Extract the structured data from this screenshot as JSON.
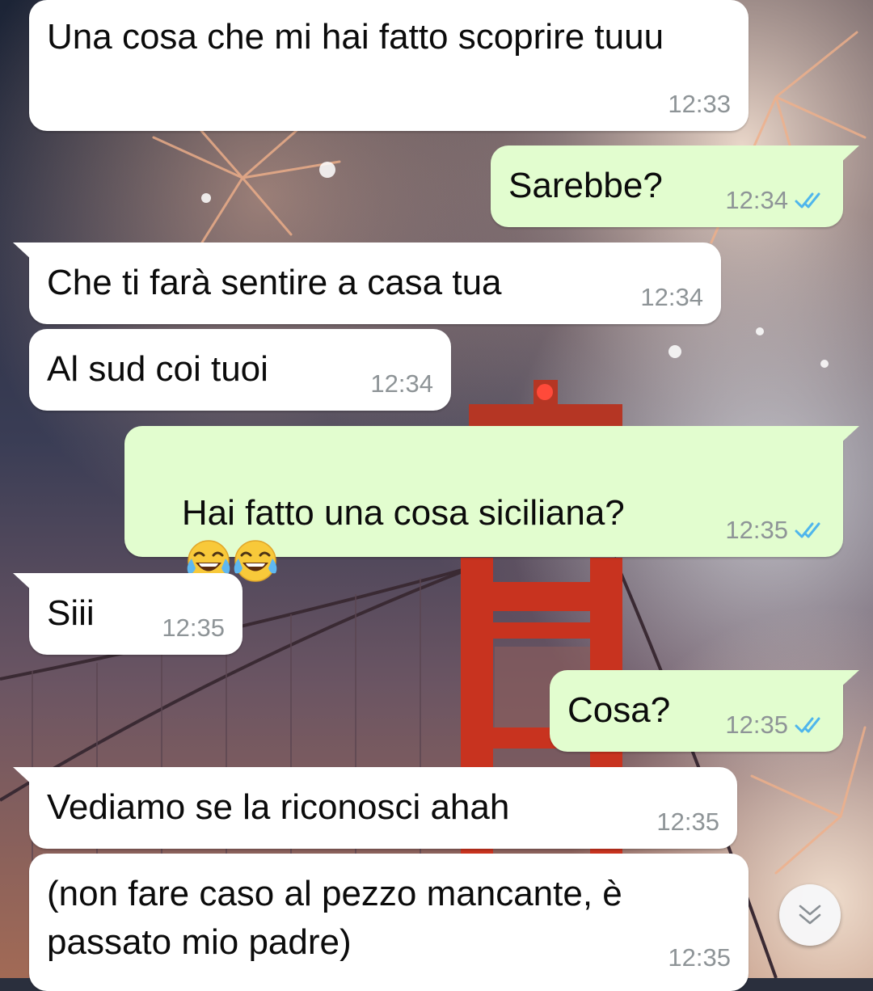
{
  "conversation": {
    "messages": [
      {
        "id": "m1",
        "direction": "incoming",
        "text": "Una cosa che mi hai fatto scoprire tuuu",
        "time": "12:33"
      },
      {
        "id": "m2",
        "direction": "outgoing",
        "text": "Sarebbe?",
        "time": "12:34",
        "status": "read"
      },
      {
        "id": "m3",
        "direction": "incoming",
        "text": "Che ti farà sentire a casa tua",
        "time": "12:34"
      },
      {
        "id": "m4",
        "direction": "incoming",
        "text": "Al sud coi tuoi",
        "time": "12:34"
      },
      {
        "id": "m5",
        "direction": "outgoing",
        "text": "Hai fatto una cosa siciliana?",
        "emoji": [
          "face-with-tears-of-joy",
          "face-with-tears-of-joy"
        ],
        "time": "12:35",
        "status": "read"
      },
      {
        "id": "m6",
        "direction": "incoming",
        "text": "Siii",
        "time": "12:35"
      },
      {
        "id": "m7",
        "direction": "outgoing",
        "text": "Cosa?",
        "time": "12:35",
        "status": "read"
      },
      {
        "id": "m8",
        "direction": "incoming",
        "text": "Vediamo se la riconosci ahah",
        "time": "12:35"
      },
      {
        "id": "m9",
        "direction": "incoming",
        "text": "(non fare caso al pezzo mancante, è passato mio padre)",
        "time": "12:35"
      }
    ]
  },
  "colors": {
    "incoming_bubble": "#ffffff",
    "outgoing_bubble": "#e2fdcf",
    "timestamp": "#8e9497",
    "read_ticks": "#4fb6ec"
  },
  "icons": {
    "read_receipt": "double-check-icon",
    "scroll_button": "chevrons-down-icon"
  },
  "wallpaper": "fireworks-over-suspension-bridge"
}
